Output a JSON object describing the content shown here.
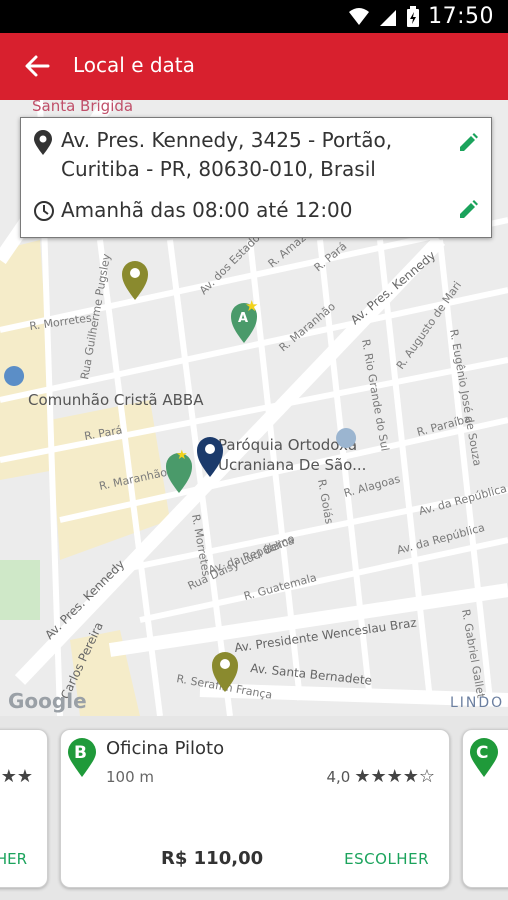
{
  "status_bar": {
    "time": "17:50"
  },
  "app_bar": {
    "title": "Local e data"
  },
  "info_card": {
    "address": "Av. Pres. Kennedy, 3425 - Portão,\nCuritiba - PR, 80630-010, Brasil",
    "schedule": "Amanhã das 08:00 até 12:00"
  },
  "map": {
    "labels": {
      "santa_brigida": "Santa Brigida",
      "comunhao": "Comunhão Cristã ABBA",
      "paroquia_l1": "Paróquia Ortodoxa",
      "paroquia_l2": "Ucraniana De São...",
      "av_kennedy_top": "Av. Pres. Kennedy",
      "av_kennedy_bottom": "Av. Pres. Kennedy",
      "av_presidente_w": "Av. Presidente Wenceslau Braz",
      "av_santa_bernadete": "Av. Santa Bernadete",
      "r_morretes_left": "R. Morretes",
      "r_morretes_mid": "R. Morretes",
      "rua_guilherme": "Rua Guilherme Pugsley",
      "r_para_left": "R. Pará",
      "r_para_top": "R. Pará",
      "r_maranhao_left": "R. Maranhão",
      "r_maranhao_top": "R. Maranhão",
      "r_alagoas": "R. Alagoas",
      "r_paraiba": "R. Paraíba",
      "r_goias": "R. Goiás",
      "r_rio_grande": "R. Rio Grande do Sul",
      "r_augusto": "R. Augusto de Mari",
      "r_eugenio": "R. Eugênio José de Souza",
      "av_estados": "Av. dos Estados",
      "r_amazonas": "R. Amazonas",
      "av_republica_1": "Av. da República",
      "av_republica_2": "Av. da República",
      "av_republica_3": "Av. da República",
      "r_guatemala": "R. Guatemala",
      "rua_daisy": "Rua Daisy Luci Berno",
      "r_serafim": "R. Serafim França",
      "carlos_pereira": "Carlos Pereira",
      "r_gabriel": "R. Gabriel Gallet",
      "lindo": "LINDO",
      "google": "Google",
      "pin_a": "A"
    }
  },
  "cards": {
    "left": {
      "choose": "HER",
      "stars": "★★"
    },
    "main": {
      "letter": "B",
      "name": "Oficina Piloto",
      "distance": "100 m",
      "rating": "4,0",
      "stars": "★★★★☆",
      "price": "R$ 110,00",
      "choose": "ESCOLHER"
    },
    "right": {
      "letter": "C"
    }
  },
  "colors": {
    "app_bar": "#d8202e",
    "accent_green": "#1ba35c",
    "pin_green": "#1f9a3a",
    "pin_olive": "#8a8a2e",
    "pin_blue": "#1b3a6b"
  }
}
